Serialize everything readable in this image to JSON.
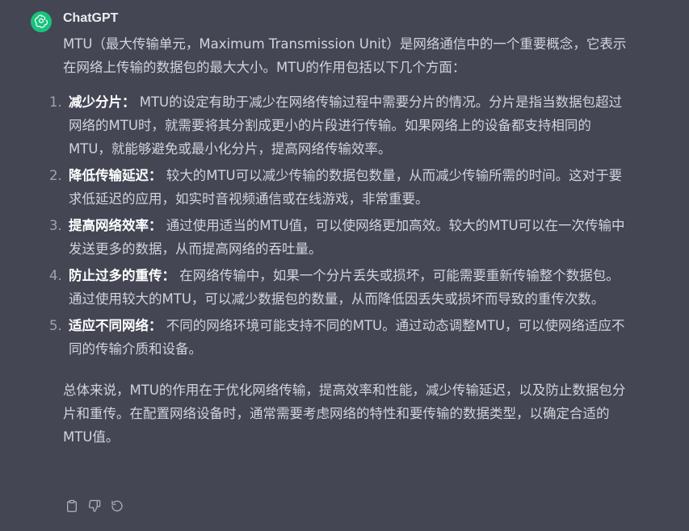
{
  "message": {
    "author": "ChatGPT",
    "intro": "MTU（最大传输单元，Maximum Transmission Unit）是网络通信中的一个重要概念，它表示在网络上传输的数据包的最大大小。MTU的作用包括以下几个方面：",
    "items": [
      {
        "num": "1.",
        "title": "减少分片：",
        "text": " MTU的设定有助于减少在网络传输过程中需要分片的情况。分片是指当数据包超过网络的MTU时，就需要将其分割成更小的片段进行传输。如果网络上的设备都支持相同的MTU，就能够避免或最小化分片，提高网络传输效率。"
      },
      {
        "num": "2.",
        "title": "降低传输延迟：",
        "text": " 较大的MTU可以减少传输的数据包数量，从而减少传输所需的时间。这对于要求低延迟的应用，如实时音视频通信或在线游戏，非常重要。"
      },
      {
        "num": "3.",
        "title": "提高网络效率：",
        "text": " 通过使用适当的MTU值，可以使网络更加高效。较大的MTU可以在一次传输中发送更多的数据，从而提高网络的吞吐量。"
      },
      {
        "num": "4.",
        "title": "防止过多的重传：",
        "text": " 在网络传输中，如果一个分片丢失或损坏，可能需要重新传输整个数据包。通过使用较大的MTU，可以减少数据包的数量，从而降低因丢失或损坏而导致的重传次数。"
      },
      {
        "num": "5.",
        "title": "适应不同网络：",
        "text": " 不同的网络环境可能支持不同的MTU。通过动态调整MTU，可以使网络适应不同的传输介质和设备。"
      }
    ],
    "summary": "总体来说，MTU的作用在于优化网络传输，提高效率和性能，减少传输延迟，以及防止数据包分片和重传。在配置网络设备时，通常需要考虑网络的特性和要传输的数据类型，以确定合适的MTU值。"
  },
  "actions": {
    "copy_icon": "clipboard-icon",
    "thumbs_down_icon": "thumbs-down-icon",
    "regenerate_icon": "regenerate-icon"
  },
  "colors": {
    "background": "#444654",
    "text": "#d1d5db",
    "avatar": "#19c37d",
    "title": "#ffffff"
  }
}
